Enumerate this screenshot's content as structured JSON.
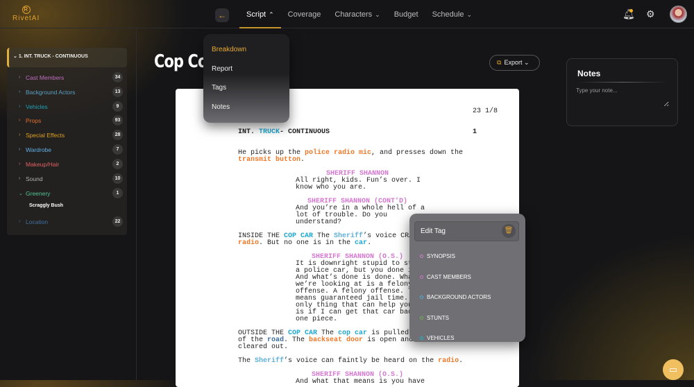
{
  "app": {
    "logo": "RivetAI"
  },
  "nav": {
    "items": [
      {
        "label": "Script",
        "chev": "⌃",
        "active": true
      },
      {
        "label": "Coverage",
        "chev": ""
      },
      {
        "label": "Characters",
        "chev": "⌄"
      },
      {
        "label": "Budget",
        "chev": ""
      },
      {
        "label": "Schedule",
        "chev": "⌄"
      }
    ]
  },
  "icons": {
    "back": "arrow-left-icon",
    "bell": "bell-icon",
    "gear": "gear-icon",
    "chat": "chat-icon"
  },
  "colors": {
    "accent": "#e0a030",
    "cast": "#d478d0",
    "vehicle": "#1ea8d0",
    "bg_actor": "#5fb0d8",
    "prop": "#f07828",
    "location": "#3a6ea0"
  },
  "sidebar": {
    "scene": "1. INT. TRUCK - CONTINUOUS",
    "items": [
      {
        "label": "Cast Members",
        "count": "34",
        "color": "#c070c0"
      },
      {
        "label": "Background Actors",
        "count": "13",
        "color": "#5aa0c0"
      },
      {
        "label": "Vehicles",
        "count": "9",
        "color": "#20a0b8"
      },
      {
        "label": "Props",
        "count": "93",
        "color": "#e07030"
      },
      {
        "label": "Special Effects",
        "count": "28",
        "color": "#e0a020"
      },
      {
        "label": "Wardrobe",
        "count": "7",
        "color": "#60b0e8"
      },
      {
        "label": "Makeup/Hair",
        "count": "2",
        "color": "#e06060"
      },
      {
        "label": "Sound",
        "count": "10",
        "color": "#b0b0b0"
      },
      {
        "label": "Greenery",
        "count": "1",
        "color": "#50c090",
        "expanded": true
      },
      {
        "label": "Location",
        "count": "22",
        "color": "#4070a0"
      }
    ],
    "greenery_sub": "Scraggly Bush"
  },
  "main": {
    "title": "Cop Co",
    "export": "Export"
  },
  "script_menu": [
    "Breakdown",
    "Report",
    "Tags",
    "Notes"
  ],
  "notes": {
    "title": "Notes",
    "placeholder": "Type your note..."
  },
  "script": {
    "page_number": "23 1/8",
    "scene_number": "1",
    "blocks": [
      {
        "type": "heading",
        "lines": [
          [
            [
              "INT. ",
              ""
            ],
            [
              "TRUCK",
              "vehicle"
            ],
            [
              "- CONTINUOUS",
              ""
            ]
          ]
        ]
      },
      {
        "type": "action",
        "lines": [
          [
            [
              "He picks up the ",
              ""
            ],
            [
              "police radio mic",
              "prop"
            ],
            [
              ", and presses down the",
              ""
            ]
          ],
          [
            [
              "transmit button",
              "prop"
            ],
            [
              ".",
              ""
            ]
          ]
        ]
      },
      {
        "type": "char",
        "lines": [
          [
            [
              "SHERIFF SHANNON",
              "cast"
            ]
          ]
        ]
      },
      {
        "type": "dialog",
        "lines": [
          [
            [
              "All right, kids. Fun’s over. I",
              ""
            ]
          ],
          [
            [
              "know who you are.",
              ""
            ]
          ]
        ]
      },
      {
        "type": "char p2",
        "lines": [
          [
            [
              "SHERIFF SHANNON (CONT'D)",
              "cast"
            ]
          ]
        ]
      },
      {
        "type": "dialog",
        "lines": [
          [
            [
              "And you’re in a whole hell of a",
              ""
            ]
          ],
          [
            [
              "lot of trouble. Do you",
              ""
            ]
          ],
          [
            [
              "understand?",
              ""
            ]
          ]
        ]
      },
      {
        "type": "action",
        "lines": [
          [
            [
              "INSIDE THE ",
              ""
            ],
            [
              "COP CAR",
              "vehicle"
            ],
            [
              " The ",
              ""
            ],
            [
              "Sheriff",
              "bg_actor"
            ],
            [
              "’s voice CRA",
              ""
            ]
          ],
          [
            [
              "radio",
              "prop"
            ],
            [
              ". But no one is in the ",
              ""
            ],
            [
              "car",
              "vehicle"
            ],
            [
              ".",
              ""
            ]
          ]
        ]
      },
      {
        "type": "char p3",
        "lines": [
          [
            [
              "SHERIFF SHANNON (O.S.)",
              "cast"
            ]
          ]
        ]
      },
      {
        "type": "dialog",
        "lines": [
          [
            [
              "It is downright stupid to st",
              ""
            ]
          ],
          [
            [
              "a police car, but you done i",
              ""
            ]
          ],
          [
            [
              "And what’s done is done. Wha",
              ""
            ]
          ],
          [
            [
              "we’re looking at is a felony",
              ""
            ]
          ],
          [
            [
              "offense. A felony offense. T",
              ""
            ]
          ],
          [
            [
              "means guaranteed jail time.",
              ""
            ]
          ],
          [
            [
              "only thing that can help you",
              ""
            ]
          ],
          [
            [
              "is if I can get that car bac",
              ""
            ]
          ],
          [
            [
              "one piece.",
              ""
            ]
          ]
        ]
      },
      {
        "type": "action",
        "lines": [
          [
            [
              "OUTSIDE THE ",
              ""
            ],
            [
              "COP CAR",
              "vehicle"
            ],
            [
              " The ",
              ""
            ],
            [
              "cop car",
              "vehicle"
            ],
            [
              " is pulled",
              ""
            ]
          ],
          [
            [
              "of the ",
              ""
            ],
            [
              "road",
              "location"
            ],
            [
              ". The ",
              ""
            ],
            [
              "backseat door",
              "prop"
            ],
            [
              " is open and",
              ""
            ]
          ],
          [
            [
              "cleared out.",
              ""
            ]
          ]
        ]
      },
      {
        "type": "action",
        "lines": [
          [
            [
              "The ",
              ""
            ],
            [
              "Sheriff",
              "bg_actor"
            ],
            [
              "’s voice can faintly be heard on the ",
              ""
            ],
            [
              "radio",
              "prop"
            ],
            [
              ".",
              ""
            ]
          ]
        ]
      },
      {
        "type": "char p3",
        "lines": [
          [
            [
              "SHERIFF SHANNON (O.S.)",
              "cast"
            ]
          ]
        ]
      },
      {
        "type": "dialog",
        "lines": [
          [
            [
              "And what that means is you have",
              ""
            ]
          ]
        ]
      }
    ]
  },
  "edit_tag": {
    "title": "Edit Tag",
    "options": [
      {
        "label": "SYNOPSIS",
        "color": "#d080c8"
      },
      {
        "label": "CAST MEMBERS",
        "color": "#d070c8"
      },
      {
        "label": "BACKGROUND ACTORS",
        "color": "#50a8d8"
      },
      {
        "label": "STUNTS",
        "color": "#70b050"
      },
      {
        "label": "VEHICLES",
        "color": "#20b0d0"
      }
    ]
  }
}
